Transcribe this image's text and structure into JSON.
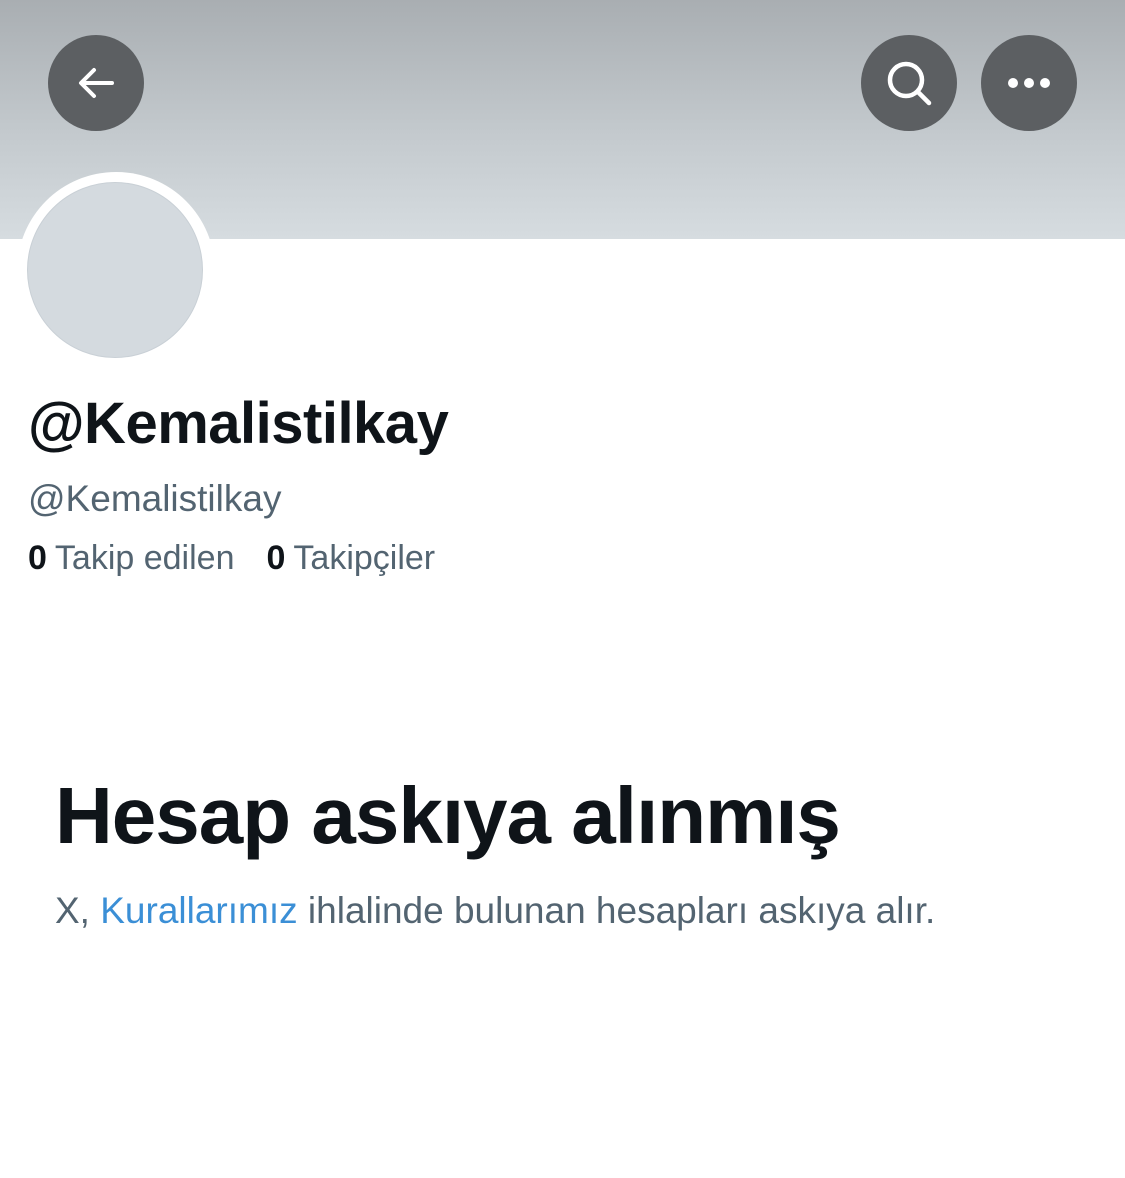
{
  "header": {
    "back_icon": "arrow-left-icon",
    "search_icon": "search-icon",
    "more_icon": "more-horizontal-icon",
    "button_color": "#5c5f62"
  },
  "profile": {
    "display_name": "@Kemalistilkay",
    "handle": "@Kemalistilkay",
    "following_count": "0",
    "following_label": "Takip edilen",
    "followers_count": "0",
    "followers_label": "Takipçiler"
  },
  "suspension": {
    "title": "Hesap askıya alınmış",
    "desc_prefix": "X, ",
    "rules_link": "Kurallarımız",
    "desc_suffix": " ihlalinde bulunan hesapları askıya alır.",
    "link_color": "#3b8fd6"
  }
}
